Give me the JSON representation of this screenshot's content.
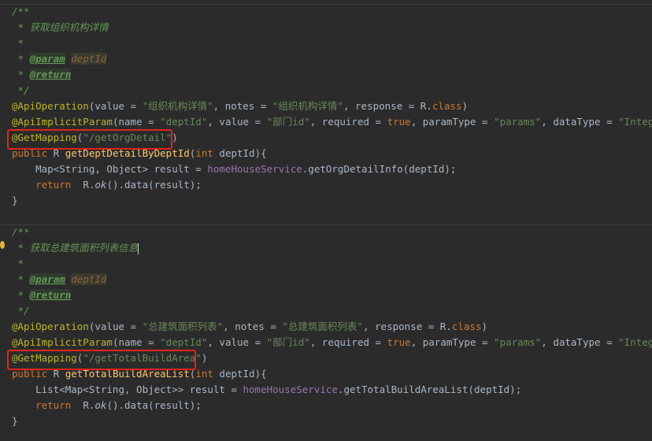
{
  "method1": {
    "doc_open": "/**",
    "doc_desc": " * 获取组织机构详情",
    "doc_blank": " *",
    "param_prefix": " * ",
    "param_tag": "@param",
    "param_name": "deptId",
    "return_prefix": " * ",
    "return_tag": "@return",
    "doc_close": " */",
    "api_op_ann": "@ApiOperation",
    "api_op_p1": "(value = ",
    "api_op_s1": "\"组织机构详情\"",
    "api_op_p2": ", notes = ",
    "api_op_s2": "\"组织机构详情\"",
    "api_op_p3": ", response = R.",
    "api_op_kw": "class",
    "api_op_p4": ")",
    "api_ip_ann": "@ApiImplicitParam",
    "api_ip_p1": "(name = ",
    "api_ip_s1": "\"deptId\"",
    "api_ip_p2": ", value = ",
    "api_ip_s2": "\"部门id\"",
    "api_ip_p3": ", required = ",
    "api_ip_kw": "true",
    "api_ip_p4": ", paramType = ",
    "api_ip_s3": "\"params\"",
    "api_ip_p5": ", dataType = ",
    "api_ip_s4": "\"Integer\"",
    "api_ip_p6": ")",
    "get_ann": "@GetMapping",
    "get_p1": "(",
    "get_path": "\"/getOrgDetail\"",
    "get_p2": ")",
    "sig_kw1": "public",
    "sig_p1": " R ",
    "sig_fn": "getDeptDetailByDeptId",
    "sig_p2": "(",
    "sig_kw2": "int",
    "sig_p3": " deptId){",
    "body1_p1": "    Map<String, Object> result = ",
    "body1_mem": "homeHouseService",
    "body1_p2": ".getOrgDetailInfo(deptId);",
    "ret_kw": "    return",
    "ret_p1": "  R.",
    "ret_ok": "ok",
    "ret_p2": "().data(result);",
    "close": "}"
  },
  "method2": {
    "doc_open": "/**",
    "doc_desc": " * 获取总建筑面积列表信息",
    "doc_blank": " *",
    "param_prefix": " * ",
    "param_tag": "@param",
    "param_name": "deptId",
    "return_prefix": " * ",
    "return_tag": "@return",
    "doc_close": " */",
    "api_op_ann": "@ApiOperation",
    "api_op_p1": "(value = ",
    "api_op_s1": "\"总建筑面积列表\"",
    "api_op_p2": ", notes = ",
    "api_op_s2": "\"总建筑面积列表\"",
    "api_op_p3": ", response = R.",
    "api_op_kw": "class",
    "api_op_p4": ")",
    "api_ip_ann": "@ApiImplicitParam",
    "api_ip_p1": "(name = ",
    "api_ip_s1": "\"deptId\"",
    "api_ip_p2": ", value = ",
    "api_ip_s2": "\"部门id\"",
    "api_ip_p3": ", required = ",
    "api_ip_kw": "true",
    "api_ip_p4": ", paramType = ",
    "api_ip_s3": "\"params\"",
    "api_ip_p5": ", dataType = ",
    "api_ip_s4": "\"Integer\"",
    "api_ip_p6": ")",
    "get_ann": "@GetMapping",
    "get_p1": "(",
    "get_path": "\"/getTotalBuildArea\"",
    "get_p2": ")",
    "sig_kw1": "public",
    "sig_p1": " R ",
    "sig_fn": "getTotalBuildAreaList",
    "sig_p2": "(",
    "sig_kw2": "int",
    "sig_p3": " deptId){",
    "body1_p1": "    List<Map<String, Object>> result = ",
    "body1_mem": "homeHouseService",
    "body1_p2": ".getTotalBuildAreaList(deptId);",
    "ret_kw": "    return",
    "ret_p1": "  R.",
    "ret_ok": "ok",
    "ret_p2": "().data(result);",
    "close": "}"
  },
  "colors": {
    "background": "#2b2b2b",
    "comment": "#629755",
    "annotation": "#bbb529",
    "string": "#6a8759",
    "keyword": "#cc7832",
    "method": "#ffc66d",
    "field": "#9876aa",
    "highlight_box": "#e0251b"
  },
  "icons": {
    "gutter": "intention-bulb-icon"
  }
}
